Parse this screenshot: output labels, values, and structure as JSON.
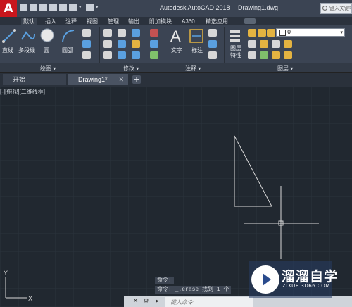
{
  "window": {
    "logo_letter": "A",
    "app_title": "Autodesk AutoCAD 2018",
    "doc_title": "Drawing1.dwg",
    "search_placeholder": "键入关键字"
  },
  "ribbon_tabs": [
    "默认",
    "插入",
    "注释",
    "视图",
    "管理",
    "输出",
    "附加模块",
    "A360",
    "精选应用"
  ],
  "panels": {
    "draw": {
      "label": "绘图 ▾",
      "tools": [
        "直线",
        "多段线",
        "圆",
        "圆弧"
      ]
    },
    "modify": {
      "label": "修改 ▾"
    },
    "annotation": {
      "label": "注释 ▾",
      "tools": [
        "文字",
        "标注"
      ]
    },
    "layers": {
      "label": "图层 ▾",
      "tools": [
        "图层\n特性"
      ],
      "current_layer": "0"
    }
  },
  "file_tabs": [
    {
      "label": "开始"
    },
    {
      "label": "Drawing1*"
    }
  ],
  "viewport": {
    "label": "[-][俯视][二维线框]"
  },
  "ucs": {
    "x_label": "X",
    "y_label": "Y"
  },
  "command": {
    "history": [
      "命令:",
      "命令: _.erase 找到 1 个"
    ],
    "input_placeholder": "键入命令"
  },
  "watermark": {
    "name": "溜溜自学",
    "url": "ZIXUE.3D66.COM"
  },
  "colors": {
    "canvas": "#212830",
    "ribbon": "#3b4453",
    "accent_logo": "#c8161d",
    "geometry": "#d9d9d9"
  }
}
